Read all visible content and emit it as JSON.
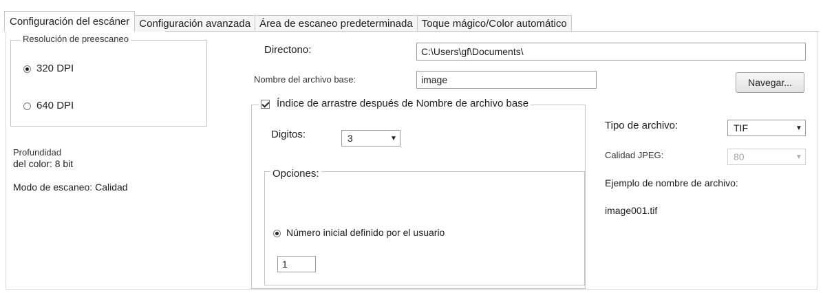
{
  "tabs": [
    {
      "label": "Configuración del escáner"
    },
    {
      "label": "Configuración avanzada"
    },
    {
      "label": "Área de escaneo predeterminada"
    },
    {
      "label": "Toque mágico/Color automático"
    }
  ],
  "prescan": {
    "legend": "Resolución de preescaneo",
    "options": [
      "320 DPI",
      "640 DPI"
    ],
    "selected": "320 DPI"
  },
  "info": {
    "color_depth_line1": "Profundidad",
    "color_depth_line2": "del color: 8 bit",
    "scan_mode": "Modo de escaneo: Calidad"
  },
  "directory": {
    "label": "Directono:",
    "value": "C:\\Users\\gf\\Documents\\"
  },
  "base_name": {
    "label": "Nombre del archivo base:",
    "value": "image"
  },
  "browse_button": "Navegar...",
  "index_group": {
    "checkbox_label": "Índice de arrastre después de Nombre de archivo base",
    "checked": true,
    "digits_label": "Digitos:",
    "digits_value": "3",
    "options_legend": "Opciones:",
    "user_start_label": "Número inicial definido por el usuario",
    "start_value": "1"
  },
  "file_type": {
    "label": "Tipo de archivo:",
    "value": "TIF"
  },
  "jpeg_quality": {
    "label": "Calidad JPEG:",
    "value": "80"
  },
  "example": {
    "label": "Ejemplo de nombre de archivo:",
    "value": "image001.tif"
  }
}
